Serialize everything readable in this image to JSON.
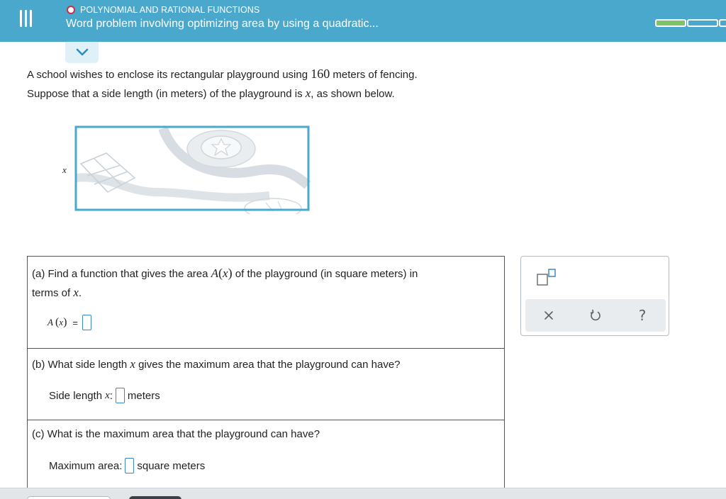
{
  "header": {
    "topic": "POLYNOMIAL AND RATIONAL FUNCTIONS",
    "title": "Word problem involving optimizing area by using a quadratic...",
    "progress": {
      "filled_segments": 1,
      "total_segments": 3
    }
  },
  "problem": {
    "line1_before": "A school wishes to enclose its rectangular playground using ",
    "line1_number": "160",
    "line1_after": " meters of fencing.",
    "line2_before": "Suppose that a side length (in meters) of the playground is ",
    "line2_var": "x",
    "line2_after": ", as shown below."
  },
  "figure": {
    "side_label": "x"
  },
  "part_a": {
    "text_before": "(a) Find a function that gives the area ",
    "func": "A",
    "arg": "x",
    "text_after": " of the playground (in square meters) in",
    "line2_before": "terms of ",
    "line2_var": "x",
    "line2_after": ".",
    "answer_lhs_func": "A",
    "answer_lhs_arg": "x",
    "equals": "="
  },
  "part_b": {
    "text_before": "(b) What side length ",
    "var": "x",
    "text_after": " gives the maximum area that the playground can have?",
    "answer_label": "Side length ",
    "answer_var": "x",
    "answer_colon": " :",
    "unit": "meters"
  },
  "part_c": {
    "text": "(c) What is the maximum area that the playground can have?",
    "answer_label": "Maximum area:",
    "unit": "square meters"
  },
  "toolbox": {
    "clear_icon": "times-icon",
    "undo_icon": "undo-icon",
    "help_label": "?"
  },
  "colors": {
    "header_bg": "#4aa8cd",
    "topic_dot": "#c92f47",
    "progress_fill": "#7cc36c",
    "answer_box_border": "#3a88c8"
  }
}
